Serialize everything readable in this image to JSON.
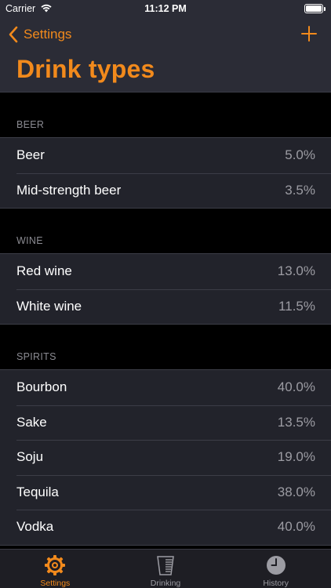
{
  "status_bar": {
    "carrier": "Carrier",
    "time": "11:12 PM"
  },
  "nav": {
    "back_label": "Settings",
    "title": "Drink types",
    "add_icon": "plus-icon",
    "back_icon": "chevron-left-icon"
  },
  "sections": [
    {
      "header": "BEER",
      "items": [
        {
          "name": "Beer",
          "value": "5.0%"
        },
        {
          "name": "Mid-strength beer",
          "value": "3.5%"
        }
      ]
    },
    {
      "header": "WINE",
      "items": [
        {
          "name": "Red wine",
          "value": "13.0%"
        },
        {
          "name": "White wine",
          "value": "11.5%"
        }
      ]
    },
    {
      "header": "SPIRITS",
      "items": [
        {
          "name": "Bourbon",
          "value": "40.0%"
        },
        {
          "name": "Sake",
          "value": "13.5%"
        },
        {
          "name": "Soju",
          "value": "19.0%"
        },
        {
          "name": "Tequila",
          "value": "38.0%"
        },
        {
          "name": "Vodka",
          "value": "40.0%"
        }
      ]
    }
  ],
  "tabs": [
    {
      "label": "Settings",
      "icon": "gear-icon",
      "active": true
    },
    {
      "label": "Drinking",
      "icon": "glass-icon",
      "active": false
    },
    {
      "label": "History",
      "icon": "clock-icon",
      "active": false
    }
  ],
  "colors": {
    "accent": "#f28a1c",
    "header_bg": "#2b2c36",
    "row_bg": "#22232b",
    "secondary_text": "#9c9ca3"
  }
}
